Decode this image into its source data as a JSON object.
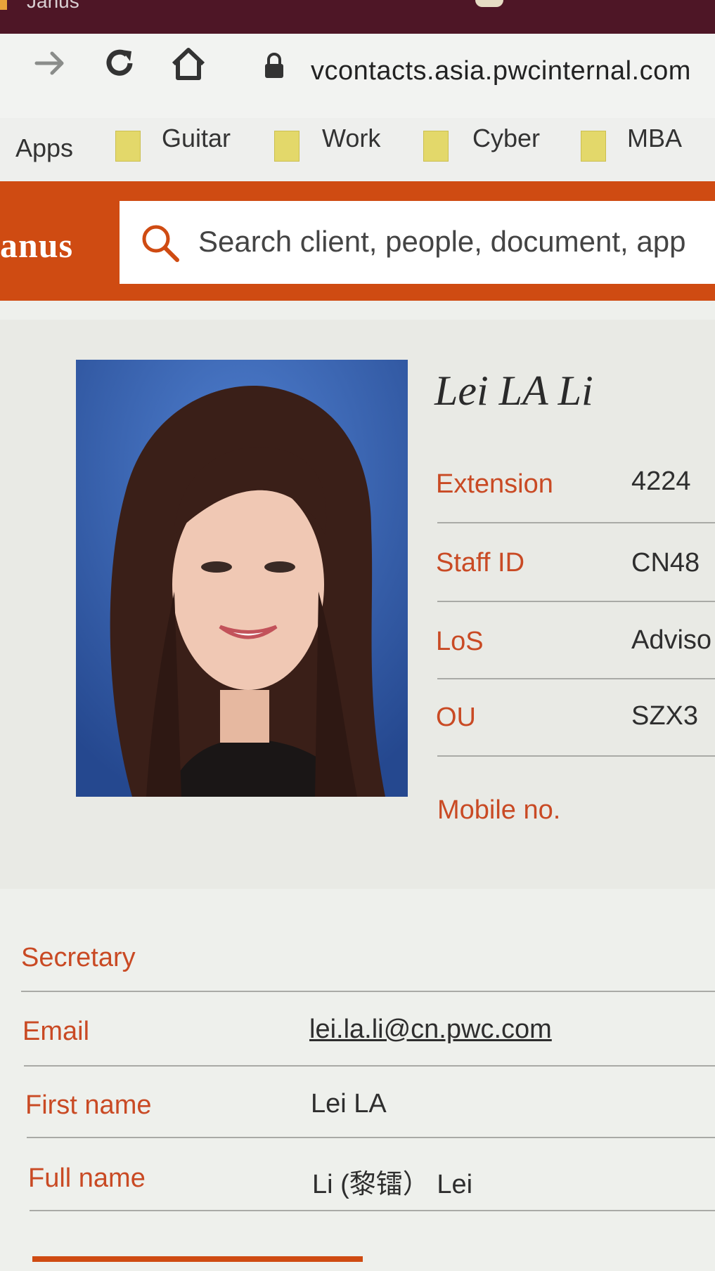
{
  "window": {
    "tab_title": "Janus"
  },
  "address_bar": {
    "url": "vcontacts.asia.pwcinternal.com"
  },
  "bookmarks": [
    {
      "label": "Apps"
    },
    {
      "label": "Guitar"
    },
    {
      "label": "Work"
    },
    {
      "label": "Cyber"
    },
    {
      "label": "MBA"
    }
  ],
  "header": {
    "logo_text": "anus",
    "search_placeholder": "Search client, people, document, app",
    "brand_color": "#cf4b12"
  },
  "profile": {
    "name": "Lei LA Li",
    "photo_alt": "Lei LA Li",
    "summary_fields": [
      {
        "label": "Extension",
        "value": "4224"
      },
      {
        "label": "Staff ID",
        "value": "CN48"
      },
      {
        "label": "LoS",
        "value": "Adviso"
      },
      {
        "label": "OU",
        "value": "SZX3"
      },
      {
        "label": "Mobile no.",
        "value": ""
      }
    ],
    "detail_fields": [
      {
        "label": "Secretary",
        "value": ""
      },
      {
        "label": "Email",
        "value": "lei.la.li@cn.pwc.com"
      },
      {
        "label": "First name",
        "value": "Lei LA"
      },
      {
        "label": "Full name",
        "value": "Li (黎镭）  Lei"
      }
    ]
  }
}
